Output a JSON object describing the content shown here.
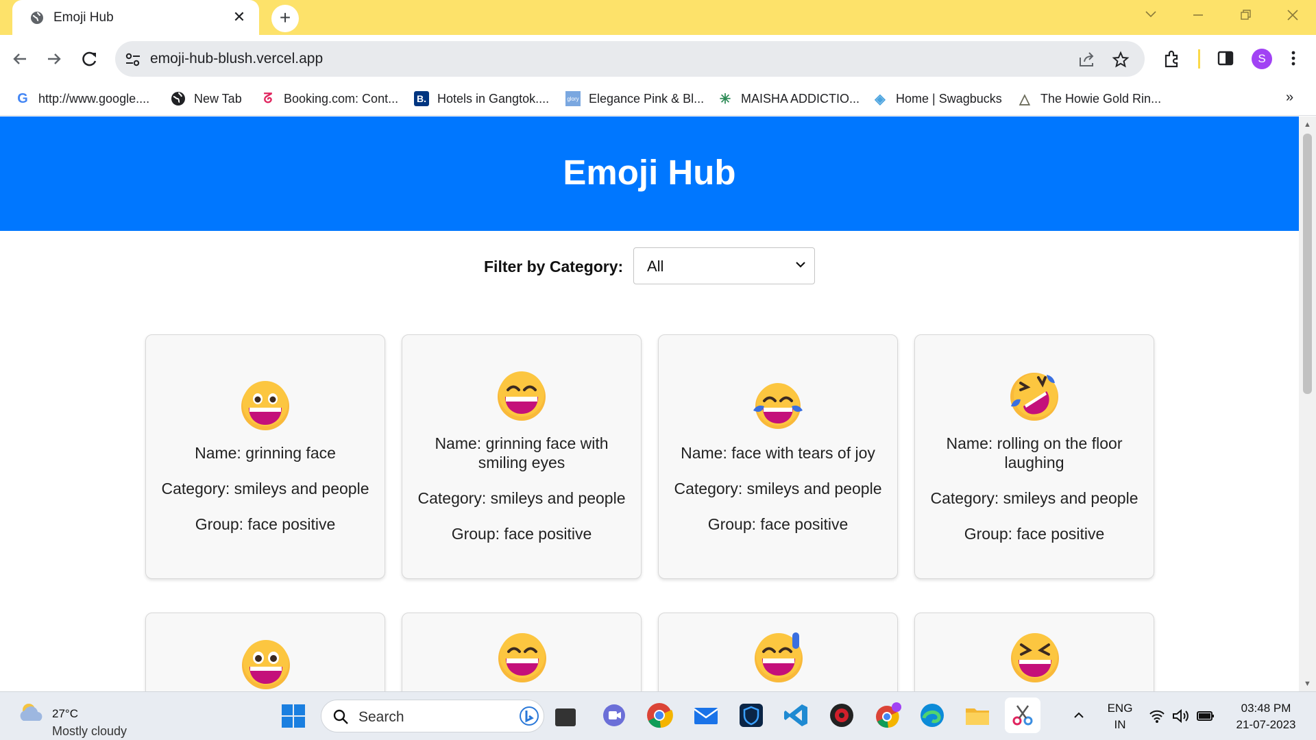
{
  "browser": {
    "tab_title": "Emoji Hub",
    "url": "emoji-hub-blush.vercel.app",
    "profile_initial": "S",
    "bookmarks": [
      {
        "label": "http://www.google....",
        "icon": "google-icon"
      },
      {
        "label": "New Tab",
        "icon": "globe-icon"
      },
      {
        "label": "Booking.com: Cont...",
        "icon": "booking-icon"
      },
      {
        "label": "Hotels in Gangtok....",
        "icon": "booking-b-icon"
      },
      {
        "label": "Elegance Pink & Bl...",
        "icon": "elegance-icon"
      },
      {
        "label": "MAISHA ADDICTIO...",
        "icon": "maisha-icon"
      },
      {
        "label": "Home | Swagbucks",
        "icon": "swagbucks-icon"
      },
      {
        "label": "The Howie Gold Rin...",
        "icon": "triangle-icon"
      }
    ],
    "bookmarks_more": "»"
  },
  "page": {
    "heading": "Emoji Hub",
    "header_color": "#0077ff",
    "filter_label": "Filter by Category:",
    "filter_value": "All",
    "cards": [
      {
        "emoji": "grinning-face",
        "name": "Name: grinning face",
        "category": "Category: smileys and people",
        "group": "Group: face positive"
      },
      {
        "emoji": "grinning-face-smiling-eyes",
        "name": "Name: grinning face with smiling eyes",
        "category": "Category: smileys and people",
        "group": "Group: face positive"
      },
      {
        "emoji": "face-tears-of-joy",
        "name": "Name: face with tears of joy",
        "category": "Category: smileys and people",
        "group": "Group: face positive"
      },
      {
        "emoji": "rolling-on-the-floor-laughing",
        "name": "Name: rolling on the floor laughing",
        "category": "Category: smileys and people",
        "group": "Group: face positive"
      }
    ],
    "partial_cards": [
      "grinning-face-big-eyes",
      "grinning-face-smiling-eyes",
      "grinning-face-sweat",
      "grinning-squinting-face"
    ]
  },
  "taskbar": {
    "weather_temp": "27°C",
    "weather_desc": "Mostly cloudy",
    "search_label": "Search",
    "lang_top": "ENG",
    "lang_bottom": "IN",
    "time": "03:48 PM",
    "date": "21-07-2023"
  }
}
